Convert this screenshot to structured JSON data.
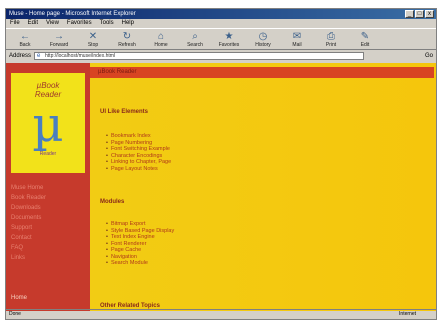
{
  "window": {
    "title": "Muse - Home page - Microsoft Internet Explorer",
    "controls": [
      "_",
      "□",
      "x"
    ]
  },
  "menubar": [
    "File",
    "Edit",
    "View",
    "Favorites",
    "Tools",
    "Help"
  ],
  "toolbar": [
    {
      "label": "Back",
      "icon": "back-icon",
      "glyph": "←"
    },
    {
      "label": "Forward",
      "icon": "forward-icon",
      "glyph": "→"
    },
    {
      "label": "Stop",
      "icon": "stop-icon",
      "glyph": "✕"
    },
    {
      "label": "Refresh",
      "icon": "refresh-icon",
      "glyph": "↻"
    },
    {
      "label": "Home",
      "icon": "home-icon",
      "glyph": "⌂"
    },
    {
      "label": "Search",
      "icon": "search-icon",
      "glyph": "⌕"
    },
    {
      "label": "Favorites",
      "icon": "favorites-icon",
      "glyph": "★"
    },
    {
      "label": "History",
      "icon": "history-icon",
      "glyph": "◷"
    },
    {
      "label": "Mail",
      "icon": "mail-icon",
      "glyph": "✉"
    },
    {
      "label": "Print",
      "icon": "print-icon",
      "glyph": "⎙"
    },
    {
      "label": "Edit",
      "icon": "edit-icon",
      "glyph": "✎"
    }
  ],
  "address": {
    "label": "Address",
    "url": "http://localhost/muse/index.html",
    "go": "Go"
  },
  "logo": {
    "line1": "µBook",
    "line2": "Reader",
    "symbol": "µ",
    "line3": "Reader"
  },
  "sidebar_links": [
    "Muse Home",
    "Book Reader",
    "Downloads",
    "Documents",
    "Support",
    "Contact",
    "FAQ",
    "Links"
  ],
  "sidebar_bottom": "Home",
  "main": {
    "band": "µBook Reader",
    "section1": "UI Like Elements",
    "list1": [
      "Bookmark Index",
      "Page Numbering",
      "Font Switching Example",
      "Character Encodings",
      "Linking to Chapter, Page",
      "Page Layout Notes"
    ],
    "section2": "Modules",
    "list2": [
      "Bitmap Export",
      "Style Based Page Display",
      "Text Index Engine",
      "Font Renderer",
      "Page Cache",
      "Navigation",
      "Search Module"
    ],
    "section3": "Other Related Topics"
  },
  "status": {
    "left": "Done",
    "right": "Internet"
  }
}
